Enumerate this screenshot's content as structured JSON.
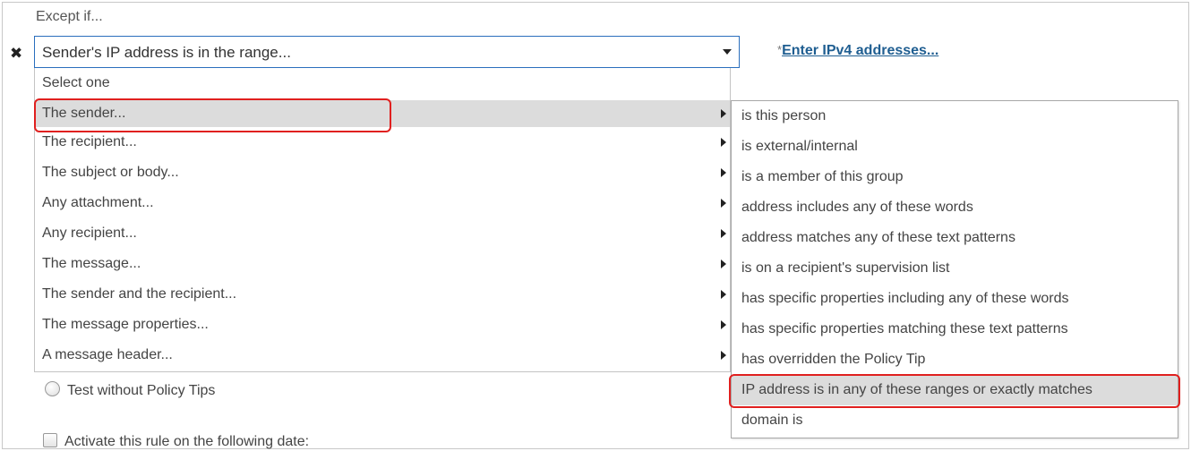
{
  "section": {
    "label": "Except if..."
  },
  "condition_select": {
    "value": "Sender's IP address is in the range..."
  },
  "ipv4_link": {
    "star": "*",
    "text": "Enter IPv4 addresses..."
  },
  "menu": {
    "items": [
      {
        "label": "Select one",
        "submenu": false
      },
      {
        "label": "The sender...",
        "submenu": true
      },
      {
        "label": "The recipient...",
        "submenu": true
      },
      {
        "label": "The subject or body...",
        "submenu": true
      },
      {
        "label": "Any attachment...",
        "submenu": true
      },
      {
        "label": "Any recipient...",
        "submenu": true
      },
      {
        "label": "The message...",
        "submenu": true
      },
      {
        "label": "The sender and the recipient...",
        "submenu": true
      },
      {
        "label": "The message properties...",
        "submenu": true
      },
      {
        "label": "A message header...",
        "submenu": true
      }
    ],
    "highlighted_index": 1
  },
  "submenu": {
    "items": [
      "is this person",
      "is external/internal",
      "is a member of this group",
      "address includes any of these words",
      "address matches any of these text patterns",
      "is on a recipient's supervision list",
      "has specific properties including any of these words",
      "has specific properties matching these text patterns",
      "has overridden the Policy Tip",
      "IP address is in any of these ranges or exactly matches",
      "domain is"
    ],
    "highlighted_index": 9
  },
  "options": {
    "radio_label": "Test without Policy Tips",
    "checkbox_label": "Activate this rule on the following date:"
  },
  "colors": {
    "highlight_outline": "#e0201f",
    "link": "#1f5e91",
    "select_border": "#2a6ebd",
    "hover_bg": "#dcdcdc"
  },
  "icons": {
    "remove": "close-icon",
    "dropdown": "chevron-down-icon",
    "submenu_caret": "chevron-right-icon"
  }
}
